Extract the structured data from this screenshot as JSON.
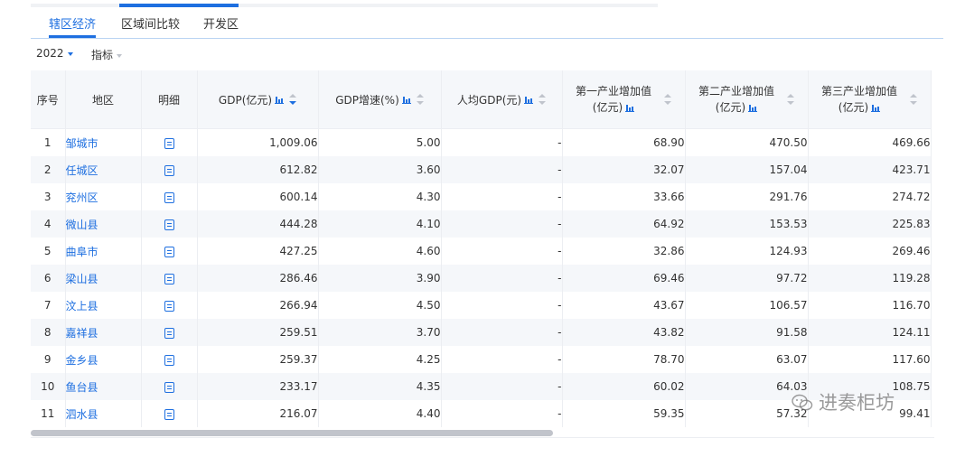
{
  "tabs": [
    {
      "label": "辖区经济",
      "active": true
    },
    {
      "label": "区域间比较",
      "active": false
    },
    {
      "label": "开发区",
      "active": false
    }
  ],
  "filters": {
    "year": "2022",
    "indicator": "指标"
  },
  "table": {
    "columns": {
      "index": "序号",
      "region": "地区",
      "detail": "明细",
      "gdp": "GDP(亿元)",
      "growth": "GDP增速(%)",
      "per_capita": "人均GDP(元)",
      "primary_line1": "第一产业增加值",
      "primary_line2": "(亿元)",
      "secondary_line1": "第二产业增加值",
      "secondary_line2": "(亿元)",
      "tertiary_line1": "第三产业增加值",
      "tertiary_line2": "(亿元)"
    },
    "rows": [
      {
        "index": "1",
        "region": "邹城市",
        "gdp": "1,009.06",
        "growth": "5.00",
        "per_capita": "-",
        "primary": "68.90",
        "secondary": "470.50",
        "tertiary": "469.66"
      },
      {
        "index": "2",
        "region": "任城区",
        "gdp": "612.82",
        "growth": "3.60",
        "per_capita": "-",
        "primary": "32.07",
        "secondary": "157.04",
        "tertiary": "423.71"
      },
      {
        "index": "3",
        "region": "兖州区",
        "gdp": "600.14",
        "growth": "4.30",
        "per_capita": "-",
        "primary": "33.66",
        "secondary": "291.76",
        "tertiary": "274.72"
      },
      {
        "index": "4",
        "region": "微山县",
        "gdp": "444.28",
        "growth": "4.10",
        "per_capita": "-",
        "primary": "64.92",
        "secondary": "153.53",
        "tertiary": "225.83"
      },
      {
        "index": "5",
        "region": "曲阜市",
        "gdp": "427.25",
        "growth": "4.60",
        "per_capita": "-",
        "primary": "32.86",
        "secondary": "124.93",
        "tertiary": "269.46"
      },
      {
        "index": "6",
        "region": "梁山县",
        "gdp": "286.46",
        "growth": "3.90",
        "per_capita": "-",
        "primary": "69.46",
        "secondary": "97.72",
        "tertiary": "119.28"
      },
      {
        "index": "7",
        "region": "汶上县",
        "gdp": "266.94",
        "growth": "4.50",
        "per_capita": "-",
        "primary": "43.67",
        "secondary": "106.57",
        "tertiary": "116.70"
      },
      {
        "index": "8",
        "region": "嘉祥县",
        "gdp": "259.51",
        "growth": "3.70",
        "per_capita": "-",
        "primary": "43.82",
        "secondary": "91.58",
        "tertiary": "124.11"
      },
      {
        "index": "9",
        "region": "金乡县",
        "gdp": "259.37",
        "growth": "4.25",
        "per_capita": "-",
        "primary": "78.70",
        "secondary": "63.07",
        "tertiary": "117.60"
      },
      {
        "index": "10",
        "region": "鱼台县",
        "gdp": "233.17",
        "growth": "4.35",
        "per_capita": "-",
        "primary": "60.02",
        "secondary": "64.03",
        "tertiary": "108.75"
      },
      {
        "index": "11",
        "region": "泗水县",
        "gdp": "216.07",
        "growth": "4.40",
        "per_capita": "-",
        "primary": "59.35",
        "secondary": "57.32",
        "tertiary": "99.41"
      }
    ]
  },
  "watermark": "进奏柜坊",
  "colors": {
    "accent": "#1e6fe0",
    "header_bg": "#f5f7fa",
    "row_alt_bg": "#f5f7fa"
  }
}
